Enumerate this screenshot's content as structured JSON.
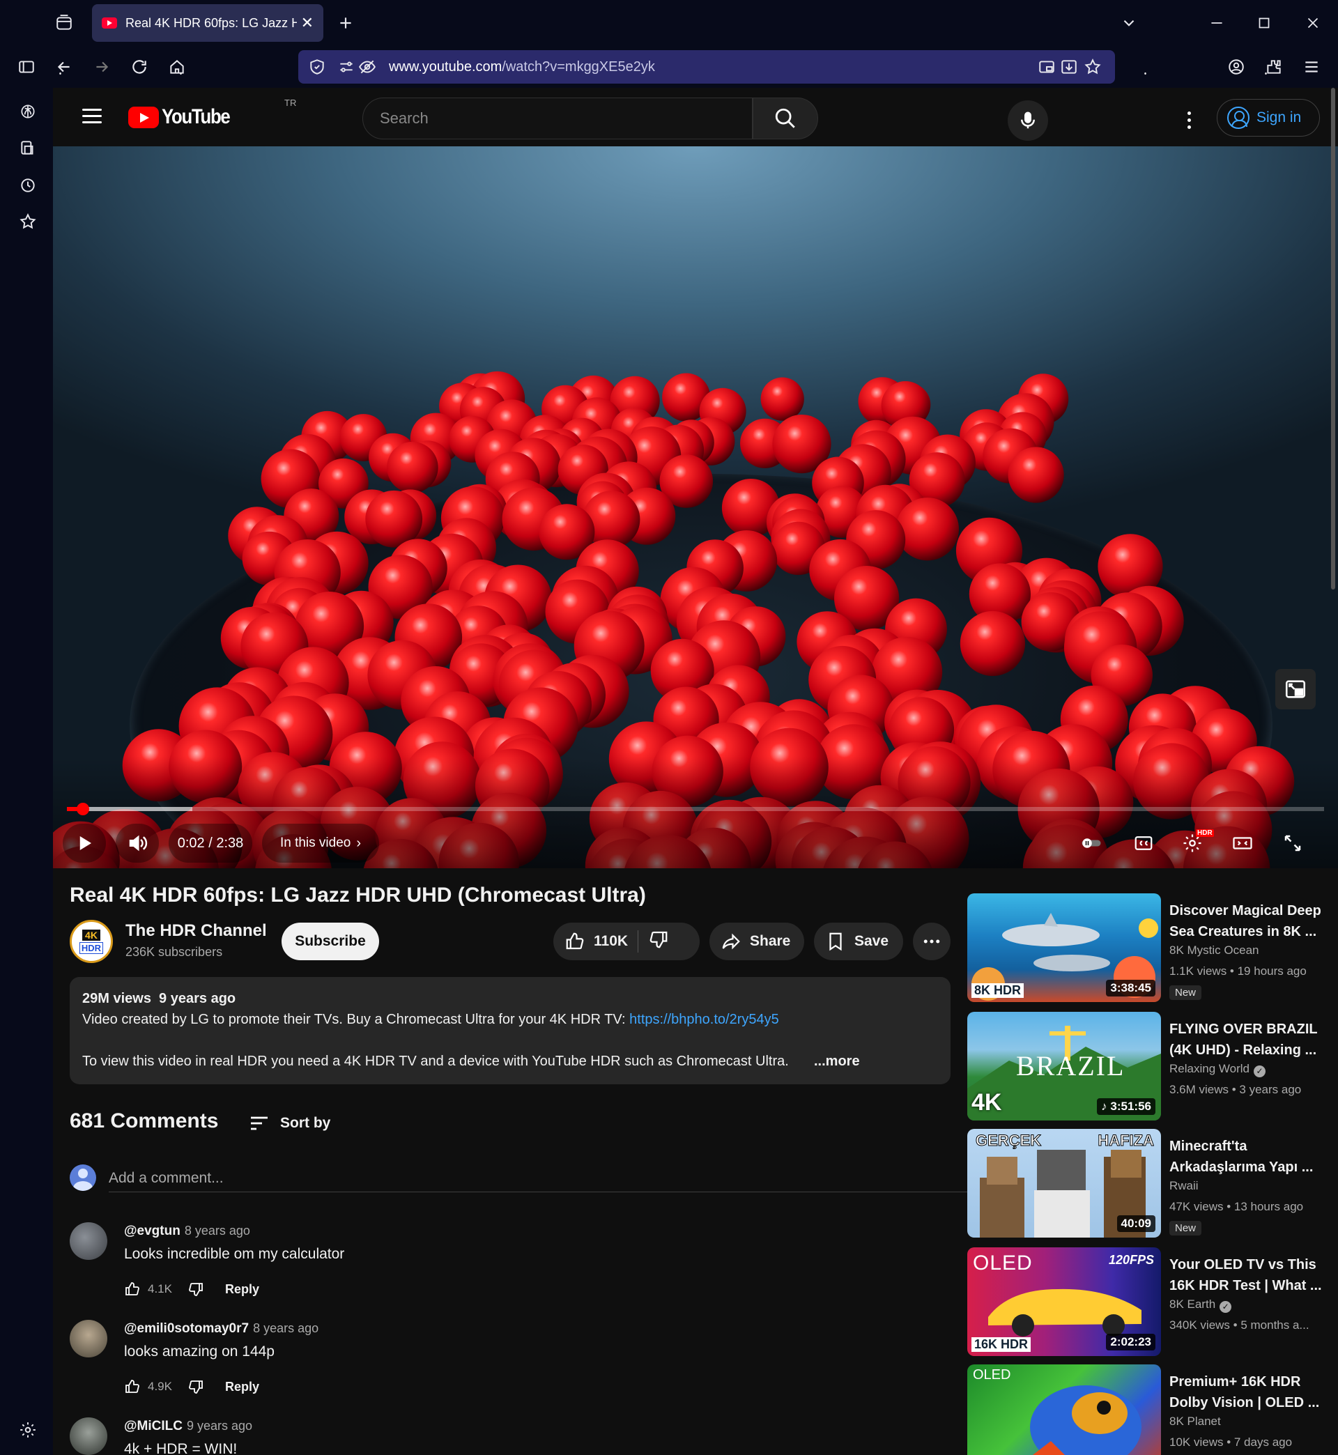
{
  "browser": {
    "tab_title": "Real 4K HDR 60fps: LG Jazz HDR UHD (Chromecast Ultra)",
    "url_domain": "www.youtube.com",
    "url_path": "/watch?v=mkggXE5e2yk",
    "icons": [
      "tab-list-icon",
      "new-tab-icon",
      "chevron-down-icon",
      "minimize-icon",
      "maximize-icon",
      "close-icon",
      "sidebar-icon",
      "back-icon",
      "forward-icon",
      "reload-icon",
      "home-icon",
      "shield-icon",
      "permissions-icon",
      "tracking-icon",
      "pip-icon",
      "download-icon",
      "bookmark-star-icon",
      "account-icon",
      "extensions-icon",
      "menu-icon"
    ],
    "sidebar_icons": [
      "chatgpt-icon",
      "bookmarks-icon",
      "history-icon",
      "star-icon",
      "settings-icon"
    ]
  },
  "youtube": {
    "logo_text": "YouTube",
    "region": "TR",
    "search_placeholder": "Search",
    "signin_label": "Sign in",
    "brand_red": "#ff0000",
    "link_color": "#3ea6ff"
  },
  "player": {
    "time": "0:02 / 2:38",
    "progress_fraction": 0.0127,
    "buffered_fraction": 0.1,
    "in_this_video": "In this video",
    "hdr_badge": "HDR"
  },
  "video": {
    "title": "Real 4K HDR 60fps: LG Jazz HDR UHD (Chromecast Ultra)",
    "channel": "The HDR Channel",
    "channel_avatar_top": "4K",
    "channel_avatar_bottom": "HDR",
    "subscribers": "236K subscribers",
    "subscribe_label": "Subscribe",
    "likes": "110K",
    "share_label": "Share",
    "save_label": "Save",
    "stats": "29M views  9 years ago",
    "desc_line1": "Video created by LG to promote their TVs. Buy a Chromecast Ultra for your 4K HDR TV: ",
    "desc_link": "https://bhpho.to/2ry54y5",
    "desc_line2": "To view this video in real HDR you need a 4K HDR TV and a device with YouTube HDR such as Chromecast Ultra.",
    "more_label": "...more"
  },
  "comments": {
    "count": "681 Comments",
    "sort_label": "Sort by",
    "add_placeholder": "Add a comment...",
    "items": [
      {
        "user": "@evgtun",
        "time": "8 years ago",
        "text": "Looks incredible om my calculator",
        "likes": "4.1K",
        "reply": "Reply"
      },
      {
        "user": "@emili0sotomay0r7",
        "time": "8 years ago",
        "text": "looks amazing on 144p",
        "likes": "4.9K",
        "reply": "Reply"
      },
      {
        "user": "@MiCILC",
        "time": "9 years ago",
        "text": "4k + HDR = WIN!",
        "likes": "",
        "reply": ""
      }
    ]
  },
  "recommendations": [
    {
      "title": "Discover Magical Deep Sea Creatures in 8K ...",
      "channel": "8K Mystic Ocean",
      "verified": false,
      "meta": "1.1K views • 19 hours ago",
      "new": "New",
      "duration": "3:38:45",
      "badge": "8K HDR"
    },
    {
      "title": "FLYING OVER BRAZIL (4K UHD) - Relaxing ...",
      "channel": "Relaxing World",
      "verified": true,
      "meta": "3.6M views • 3 years ago",
      "new": "",
      "duration": "3:51:56",
      "badge": "4K",
      "thumb_text": "BRAZIL"
    },
    {
      "title": "Minecraft'ta Arkadaşlarıma Yapı ...",
      "channel": "Rwaii",
      "verified": false,
      "meta": "47K views • 13 hours ago",
      "new": "New",
      "duration": "40:09",
      "badge": "",
      "thumb_left": "GERÇEK",
      "thumb_right": "HAFIZA"
    },
    {
      "title": "Your OLED TV vs This 16K HDR Test | What ...",
      "channel": "8K Earth",
      "verified": true,
      "meta": "340K views • 5 months a...",
      "new": "",
      "duration": "2:02:23",
      "badge": "16K HDR",
      "thumb_text": "OLED",
      "thumb_fps": "120FPS"
    },
    {
      "title": "Premium+ 16K HDR Dolby Vision | OLED ...",
      "channel": "8K Planet",
      "verified": false,
      "meta": "10K views • 7 days ago",
      "new": "",
      "duration": "",
      "badge": "",
      "thumb_text": "OLED"
    }
  ]
}
